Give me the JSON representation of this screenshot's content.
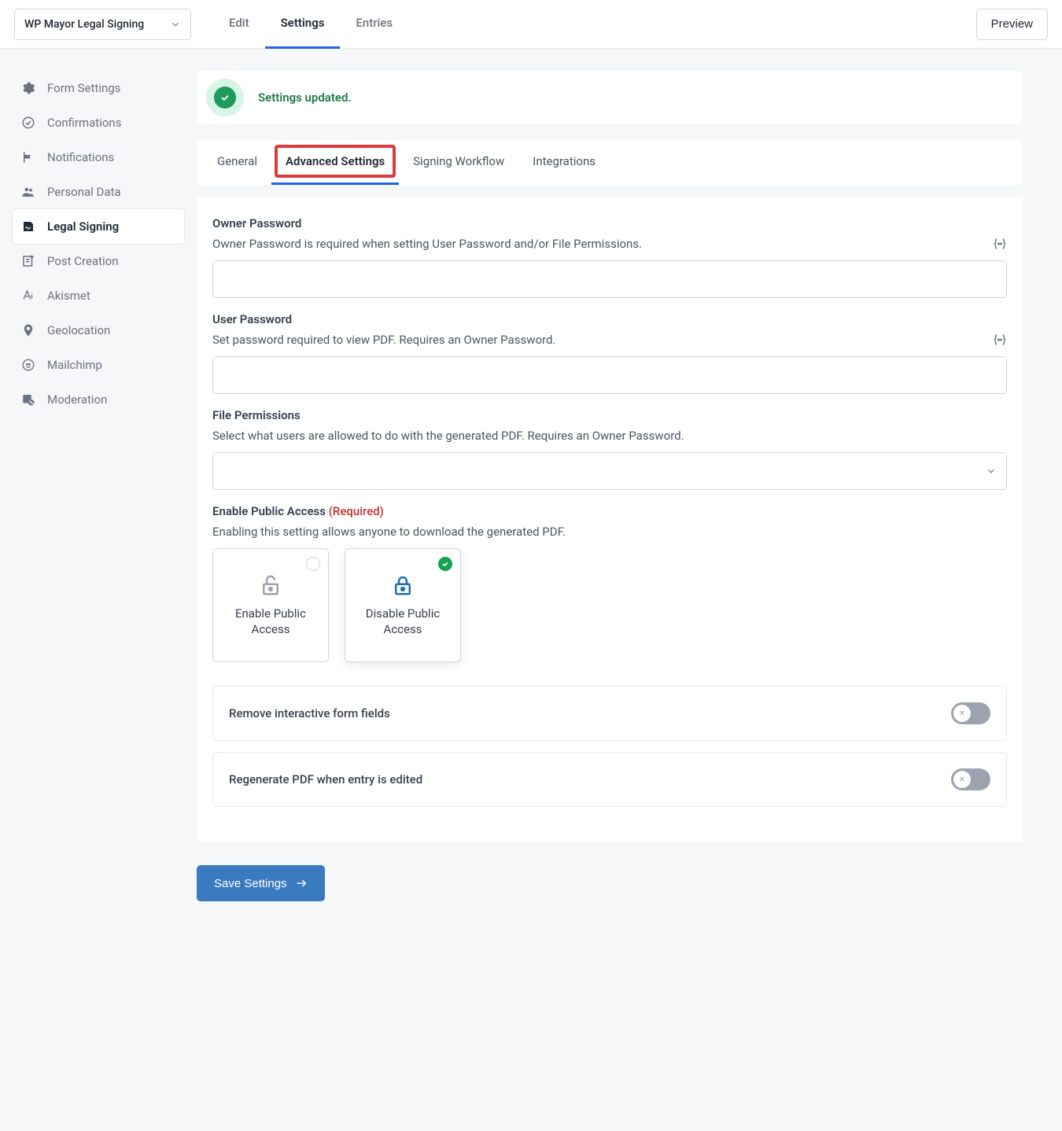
{
  "header": {
    "form_selector": "WP Mayor Legal Signing",
    "tabs": [
      "Edit",
      "Settings",
      "Entries"
    ],
    "active_tab_index": 1,
    "preview": "Preview"
  },
  "sidebar": {
    "items": [
      {
        "label": "Form Settings",
        "icon": "gear"
      },
      {
        "label": "Confirmations",
        "icon": "check-circle"
      },
      {
        "label": "Notifications",
        "icon": "flag"
      },
      {
        "label": "Personal Data",
        "icon": "people"
      },
      {
        "label": "Legal Signing",
        "icon": "sign"
      },
      {
        "label": "Post Creation",
        "icon": "post"
      },
      {
        "label": "Akismet",
        "icon": "akismet"
      },
      {
        "label": "Geolocation",
        "icon": "pin"
      },
      {
        "label": "Mailchimp",
        "icon": "mailchimp"
      },
      {
        "label": "Moderation",
        "icon": "moderation"
      }
    ],
    "active_index": 4
  },
  "notice": {
    "text": "Settings updated."
  },
  "sub_tabs": {
    "items": [
      "General",
      "Advanced Settings",
      "Signing Workflow",
      "Integrations"
    ],
    "active_index": 1,
    "highlight_index": 1
  },
  "fields": {
    "owner_pw": {
      "label": "Owner Password",
      "desc": "Owner Password is required when setting User Password and/or File Permissions.",
      "value": ""
    },
    "user_pw": {
      "label": "User Password",
      "desc": "Set password required to view PDF. Requires an Owner Password.",
      "value": ""
    },
    "file_perm": {
      "label": "File Permissions",
      "desc": "Select what users are allowed to do with the generated PDF. Requires an Owner Password.",
      "value": ""
    },
    "public_access": {
      "label": "Enable Public Access",
      "required": "(Required)",
      "desc": "Enabling this setting allows anyone to download the generated PDF.",
      "options": [
        "Enable Public Access",
        "Disable Public Access"
      ],
      "selected_index": 1
    },
    "toggle1": {
      "label": "Remove interactive form fields",
      "on": false
    },
    "toggle2": {
      "label": "Regenerate PDF when entry is edited",
      "on": false
    }
  },
  "save_button": "Save Settings"
}
